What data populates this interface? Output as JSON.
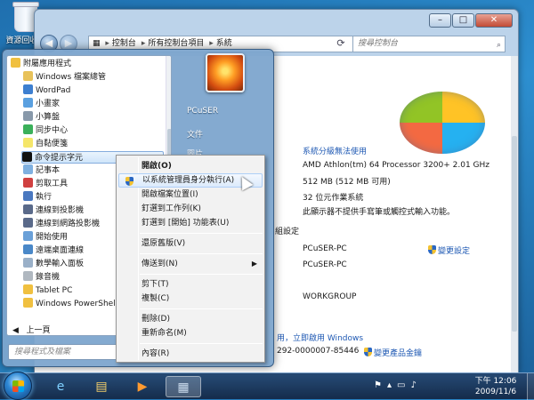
{
  "desktop": {
    "recycle_bin_label": "資源回收筒"
  },
  "window": {
    "breadcrumb": [
      "控制台",
      "所有控制台項目",
      "系統"
    ],
    "search_placeholder": "搜尋控制台",
    "system_rows": [
      {
        "text": "系統分級無法使用",
        "type": "link"
      },
      {
        "text": "AMD Athlon(tm) 64 Processor 3200+   2.01 GHz",
        "type": "text"
      },
      {
        "text": "512 MB (512 MB 可用)",
        "type": "text"
      },
      {
        "text": "32 位元作業系統",
        "type": "text"
      },
      {
        "text": "此顯示器不提供手寫筆或觸控式輸入功能。",
        "type": "text"
      }
    ],
    "settings_fragment": "組設定",
    "computer_name": "PCuSER-PC",
    "change_settings": "變更設定",
    "full_computer_name": "PCuSER-PC",
    "workgroup": "WORKGROUP",
    "activation_fragment": "用，立即啟用 Windows",
    "product_id_fragment": "292-0000007-85446",
    "change_product_key": "變更產品金鑰"
  },
  "start_menu": {
    "programs": [
      "附屬應用程式",
      "Windows 檔案總管",
      "WordPad",
      "小畫家",
      "小算盤",
      "同步中心",
      "自黏便箋",
      "命令提示字元",
      "記事本",
      "剪取工具",
      "執行",
      "連線到投影機",
      "連線到網路投影機",
      "開始使用",
      "遠端桌面連線",
      "數學輸入面板",
      "錄音機",
      "Tablet PC",
      "Windows PowerShell"
    ],
    "back_label": "上一頁",
    "search_placeholder": "搜尋程式及檔案",
    "user_name": "PCuSER",
    "right_items": [
      "文件",
      "圖片"
    ]
  },
  "context_menu": {
    "items": [
      "開啟(O)",
      "以系統管理員身分執行(A)",
      "開啟檔案位置(I)",
      "釘選到工作列(K)",
      "釘選到 [開始] 功能表(U)",
      "還原舊版(V)",
      "傳送到(N)",
      "剪下(T)",
      "複製(C)",
      "刪除(D)",
      "重新命名(M)",
      "內容(R)"
    ]
  },
  "taskbar": {
    "time": "下午 12:06",
    "date": "2009/11/6"
  },
  "colors": {
    "link": "#1e58b3",
    "highlight": "#cfe5fa"
  }
}
